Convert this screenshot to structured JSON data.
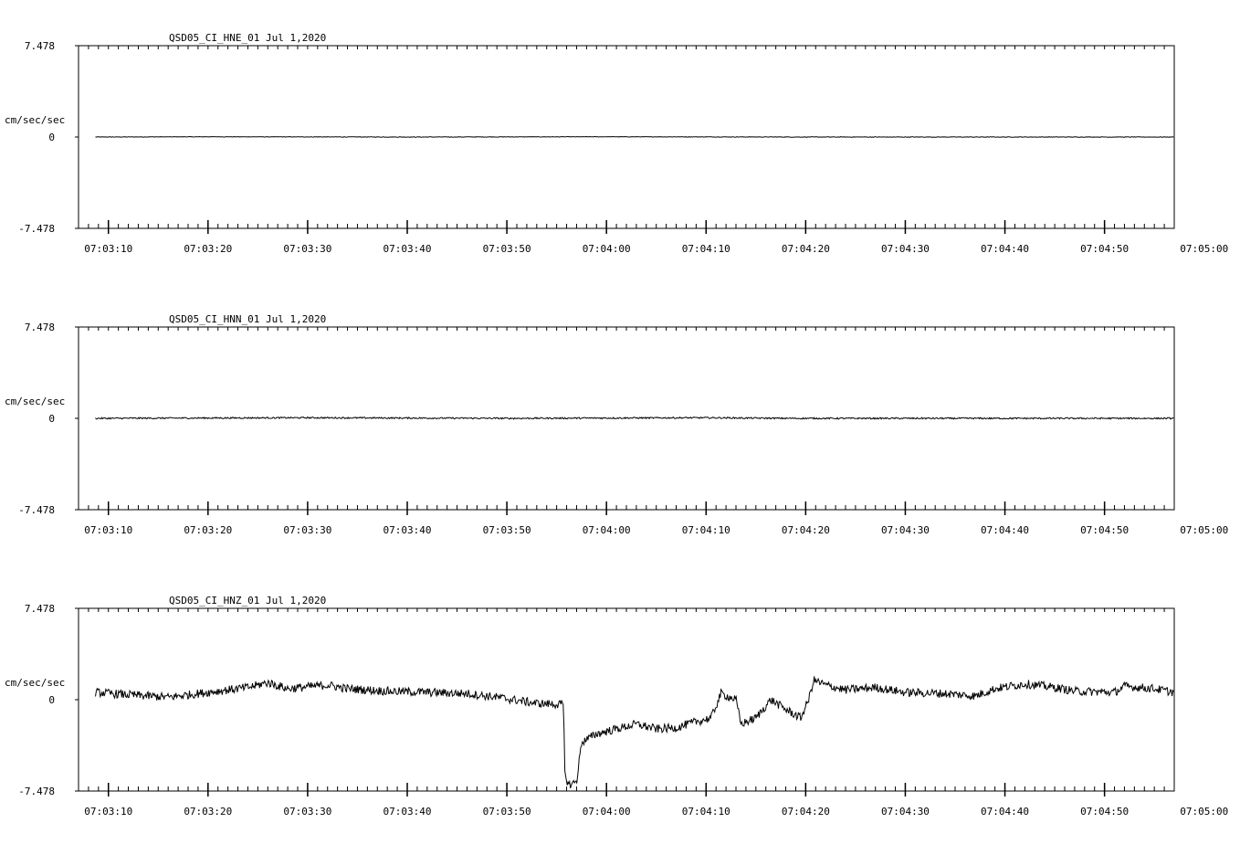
{
  "chart_data": [
    {
      "type": "line",
      "title": "QSD05_CI_HNE_01  Jul 1,2020",
      "ylabel": "cm/sec/sec",
      "ylim": [
        -7.478,
        7.478
      ],
      "yticks": [
        "7.478",
        "0",
        "-7.478"
      ],
      "xticks": [
        "07:03:10",
        "07:03:20",
        "07:03:30",
        "07:03:40",
        "07:03:50",
        "07:04:00",
        "07:04:10",
        "07:04:20",
        "07:04:30",
        "07:04:40",
        "07:04:50",
        "07:05:00"
      ],
      "xlim_seconds": [
        187.0,
        297.0
      ],
      "x_start_seconds": 188.7,
      "x_end_seconds": 297.0,
      "grid": false,
      "series": [
        {
          "keypoints": [
            [
              188.7,
              0.0
            ],
            [
              200.0,
              0.02
            ],
            [
              220.0,
              0.0
            ],
            [
              240.0,
              0.02
            ],
            [
              260.0,
              0.0
            ],
            [
              280.0,
              0.0
            ],
            [
              297.0,
              0.0
            ]
          ],
          "noise": 0.02
        }
      ]
    },
    {
      "type": "line",
      "title": "QSD05_CI_HNN_01  Jul 1,2020",
      "ylabel": "cm/sec/sec",
      "ylim": [
        -7.478,
        7.478
      ],
      "yticks": [
        "7.478",
        "0",
        "-7.478"
      ],
      "xticks": [
        "07:03:10",
        "07:03:20",
        "07:03:30",
        "07:03:40",
        "07:03:50",
        "07:04:00",
        "07:04:10",
        "07:04:20",
        "07:04:30",
        "07:04:40",
        "07:04:50",
        "07:05:00"
      ],
      "xlim_seconds": [
        187.0,
        297.0
      ],
      "x_start_seconds": 188.7,
      "x_end_seconds": 297.0,
      "grid": false,
      "series": [
        {
          "keypoints": [
            [
              188.7,
              0.0
            ],
            [
              210.0,
              0.05
            ],
            [
              230.0,
              0.0
            ],
            [
              250.0,
              0.05
            ],
            [
              258.0,
              0.0
            ],
            [
              297.0,
              0.0
            ]
          ],
          "noise": 0.06
        }
      ]
    },
    {
      "type": "line",
      "title": "QSD05_CI_HNZ_01  Jul 1,2020",
      "ylabel": "cm/sec/sec",
      "ylim": [
        -7.478,
        7.478
      ],
      "yticks": [
        "7.478",
        "0",
        "-7.478"
      ],
      "xticks": [
        "07:03:10",
        "07:03:20",
        "07:03:30",
        "07:03:40",
        "07:03:50",
        "07:04:00",
        "07:04:10",
        "07:04:20",
        "07:04:30",
        "07:04:40",
        "07:04:50",
        "07:05:00"
      ],
      "xlim_seconds": [
        187.0,
        297.0
      ],
      "x_start_seconds": 188.7,
      "x_end_seconds": 297.0,
      "grid": false,
      "series": [
        {
          "keypoints": [
            [
              188.7,
              0.6
            ],
            [
              192.0,
              0.4
            ],
            [
              196.0,
              0.2
            ],
            [
              200.0,
              0.6
            ],
            [
              204.0,
              1.0
            ],
            [
              206.0,
              1.4
            ],
            [
              208.0,
              0.9
            ],
            [
              212.0,
              1.2
            ],
            [
              214.0,
              0.9
            ],
            [
              218.0,
              0.7
            ],
            [
              222.0,
              0.6
            ],
            [
              226.0,
              0.5
            ],
            [
              229.0,
              0.2
            ],
            [
              233.0,
              -0.3
            ],
            [
              235.7,
              -0.4
            ],
            [
              235.8,
              -6.0
            ],
            [
              236.2,
              -7.0
            ],
            [
              237.0,
              -6.7
            ],
            [
              237.5,
              -3.5
            ],
            [
              239.0,
              -2.8
            ],
            [
              241.0,
              -2.4
            ],
            [
              243.0,
              -2.0
            ],
            [
              245.0,
              -2.4
            ],
            [
              247.0,
              -2.3
            ],
            [
              249.0,
              -1.8
            ],
            [
              250.5,
              -1.5
            ],
            [
              251.5,
              0.5
            ],
            [
              253.0,
              0.0
            ],
            [
              253.5,
              -2.0
            ],
            [
              255.0,
              -1.5
            ],
            [
              256.5,
              0.0
            ],
            [
              258.0,
              -0.8
            ],
            [
              259.5,
              -1.5
            ],
            [
              260.3,
              0.0
            ],
            [
              260.8,
              1.6
            ],
            [
              262.0,
              1.2
            ],
            [
              264.0,
              0.8
            ],
            [
              267.0,
              1.0
            ],
            [
              270.0,
              0.6
            ],
            [
              274.0,
              0.5
            ],
            [
              277.0,
              0.3
            ],
            [
              279.0,
              0.9
            ],
            [
              282.0,
              1.3
            ],
            [
              285.0,
              1.0
            ],
            [
              287.0,
              0.7
            ],
            [
              291.0,
              0.6
            ],
            [
              292.0,
              1.1
            ],
            [
              295.0,
              0.9
            ],
            [
              297.0,
              0.6
            ]
          ],
          "noise": 0.35
        }
      ]
    }
  ]
}
